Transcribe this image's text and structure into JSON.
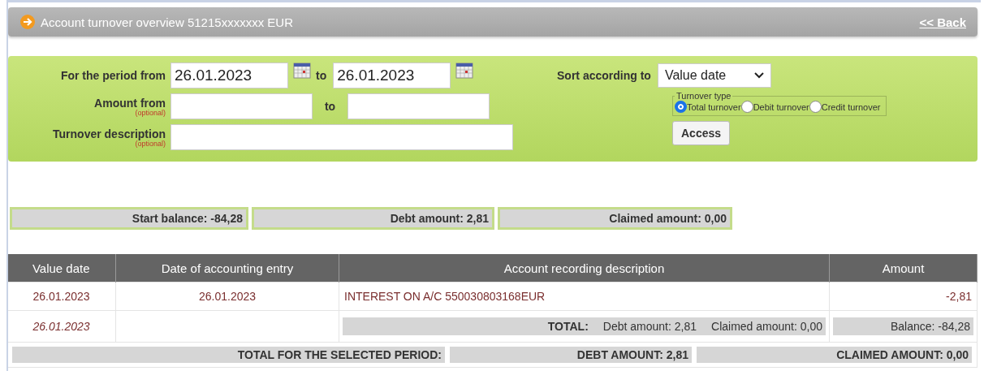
{
  "header": {
    "title": "Account turnover overview 51215xxxxxxx EUR",
    "back_link": "<< Back"
  },
  "filter": {
    "period": {
      "label": "For the period from",
      "from": "26.01.2023",
      "to_label": "to",
      "to": "26.01.2023"
    },
    "amount": {
      "label": "Amount from",
      "hint": "(optional)",
      "to_label": "to"
    },
    "description": {
      "label": "Turnover description",
      "hint": "(optional)"
    },
    "sort": {
      "label": "Sort according to",
      "value": "Value date"
    },
    "turnover_type": {
      "legend": "Turnover type",
      "options": [
        {
          "label": "Total turnover",
          "selected": true
        },
        {
          "label": "Debit turnover",
          "selected": false
        },
        {
          "label": "Credit turnover",
          "selected": false
        }
      ]
    },
    "access_button": "Access"
  },
  "summary": [
    "Start balance: -84,28",
    "Debt amount: 2,81",
    "Claimed amount: 0,00"
  ],
  "table": {
    "columns": [
      "Value date",
      "Date of accounting entry",
      "Account recording description",
      "Amount"
    ],
    "rows": [
      {
        "value_date": "26.01.2023",
        "entry_date": "26.01.2023",
        "description": "INTEREST ON A/C 550030803168EUR",
        "amount": "-2,81"
      }
    ],
    "day_total": {
      "date": "26.01.2023",
      "label": "TOTAL:",
      "debt": "Debt amount: 2,81",
      "claimed": "Claimed amount: 0,00",
      "balance": "Balance: -84,28"
    },
    "period_total": {
      "label": "TOTAL FOR THE SELECTED PERIOD:",
      "debt": "DEBT AMOUNT: 2,81",
      "claimed": "CLAIMED AMOUNT: 0,00"
    }
  }
}
